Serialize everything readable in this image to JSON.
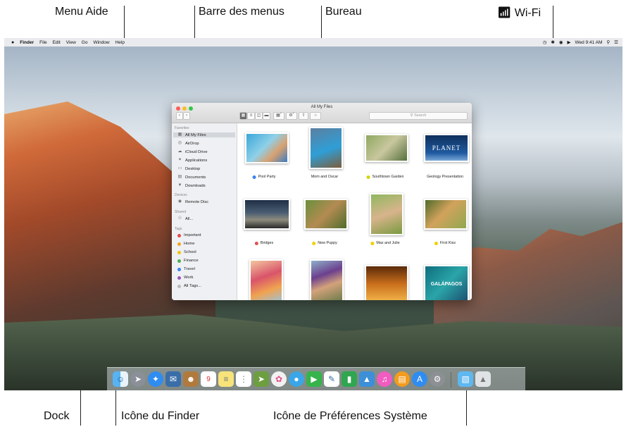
{
  "callouts": {
    "menu_aide": "Menu Aide",
    "barre_menus": "Barre des menus",
    "bureau": "Bureau",
    "wifi": "Wi-Fi",
    "dock": "Dock",
    "finder_icon": "Icône du Finder",
    "prefs_icon": "Icône de Préférences Système"
  },
  "menubar": {
    "apple": "",
    "app": "Finder",
    "items": [
      "File",
      "Edit",
      "View",
      "Go",
      "Window",
      "Help"
    ],
    "clock": "Wed 9:41 AM",
    "status_icons": [
      "time-machine-icon",
      "bluetooth-icon",
      "wifi-icon",
      "volume-icon",
      "spotlight-icon",
      "notification-center-icon"
    ]
  },
  "window": {
    "title": "All My Files",
    "search_placeholder": "Search",
    "sidebar": {
      "favorites_head": "Favorites",
      "favorites": [
        "All My Files",
        "AirDrop",
        "iCloud Drive",
        "Applications",
        "Desktop",
        "Documents",
        "Downloads"
      ],
      "devices_head": "Devices",
      "devices": [
        "Remote Disc"
      ],
      "shared_head": "Shared",
      "shared": [
        "All..."
      ],
      "tags_head": "Tags",
      "tags": [
        "Important",
        "Home",
        "School",
        "Finance",
        "Travel",
        "Work",
        "All Tags..."
      ]
    },
    "files": [
      {
        "name": "Pool Party",
        "tag": "#3b82f6"
      },
      {
        "name": "Mom and Oscar",
        "tag": ""
      },
      {
        "name": "Southtown Garden",
        "tag": "#d4d400"
      },
      {
        "name": "Geology Presentation",
        "tag": ""
      },
      {
        "name": "Bridges",
        "tag": "#e05050"
      },
      {
        "name": "New Puppy",
        "tag": "#f0d000"
      },
      {
        "name": "Max and Julie",
        "tag": "#f0d000"
      },
      {
        "name": "First Kiss",
        "tag": "#f0d000"
      }
    ],
    "planet_text": "PLANET",
    "galapagos_text": "GALÁPAGOS"
  },
  "colors": {
    "tag_important": "#e5484d",
    "tag_home": "#f5a623",
    "tag_school": "#f1c40f",
    "tag_finance": "#4caf50",
    "tag_travel": "#3b82f6",
    "tag_work": "#9b59b6",
    "tag_all": "#bbbbbb"
  }
}
